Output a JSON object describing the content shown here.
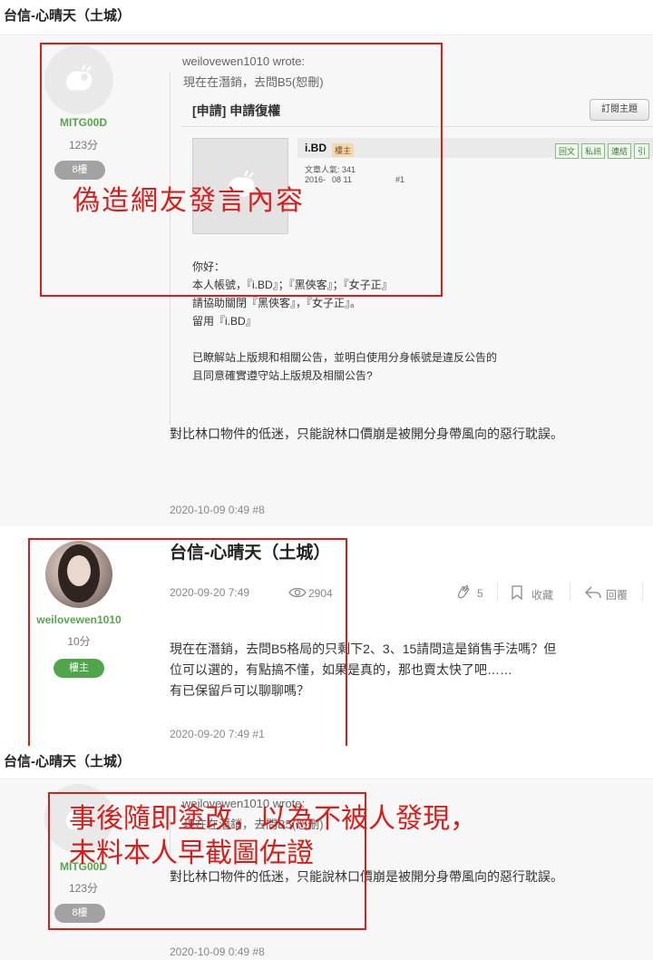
{
  "top_header": {
    "topic_title": "台信-心晴天（土城）"
  },
  "post_8_original": {
    "user": {
      "name": "MITG00D",
      "score": "123分",
      "floor_badge": "8樓"
    },
    "quote": {
      "author_line": "weilovewen1010 wrote:",
      "text": "現在在潛銷，去問B5(恕刪)"
    },
    "embedded_screenshot": {
      "title": "[申請] 申請復權",
      "subscribe_button": "訂閱主題",
      "poster_name": "i.BD",
      "mod_badge": "樓主",
      "actions": [
        "回文",
        "私訊",
        "連結",
        "引"
      ],
      "popularity": "文章人氣: 341",
      "date_fragment": "2016-",
      "date_fragment_2": "08 11",
      "floor_fragment": "#1",
      "body_lines": [
        "你好：",
        "本人帳號，『i.BD』；『黑俠客』；『女子正』",
        "請協助關閉『黑俠客』，『女子正』。",
        "留用『i.BD』",
        "",
        "已瞭解站上版規和相關公告，並明白使用分身帳號是違反公告的",
        "且同意確實遵守站上版規及相關公告?"
      ]
    },
    "reply_text": "對比林口物件的低迷，只能說林口價崩是被開分身帶風向的惡行耽誤。",
    "footer": "2020-10-09 0:49 #8"
  },
  "annotation_top": "偽造網友發言內容",
  "post_1": {
    "title": "台信-心晴天（土城）",
    "user": {
      "name": "weilovewen1010",
      "score": "10分",
      "badge": "樓主"
    },
    "date": "2020-09-20 7:49",
    "views": "2904",
    "likes": "5",
    "collect_label": "收藏",
    "reply_label": "回覆",
    "body_lines": [
      "現在在潛銷，去問B5格局的只剩下2、3、15請問這是銷售手法嗎？但",
      "位可以選的，有點搞不懂，如果是真的，那也賣太快了吧……",
      "有已保留戶可以聊聊嗎？"
    ],
    "footer": "2020-09-20 7:49 #1"
  },
  "bottom_header": {
    "topic_title": "台信-心晴天（土城）"
  },
  "post_8_edited": {
    "user": {
      "name": "MITG00D",
      "score": "123分",
      "floor_badge": "8樓"
    },
    "quote": {
      "author_line": "weilovewen1010 wrote:",
      "text": "現在在潛銷，去問B5(恕刪)"
    },
    "reply_text": "對比林口物件的低迷，只能說林口價崩是被開分身帶風向的惡行耽誤。",
    "footer": "2020-10-09 0:49 #8"
  },
  "annotation_bottom": {
    "line1": "事後隨即塗改，以為不被人發現，",
    "line2": "未料本人早截圖佐證"
  },
  "colors": {
    "annotation_red": "#d3201d",
    "username_green": "#5aa351",
    "badge_green": "#4fa64a"
  },
  "icons": [
    "sheep-logo-icon",
    "eye-icon",
    "clap-icon",
    "bookmark-icon",
    "reply-arrow-icon"
  ]
}
